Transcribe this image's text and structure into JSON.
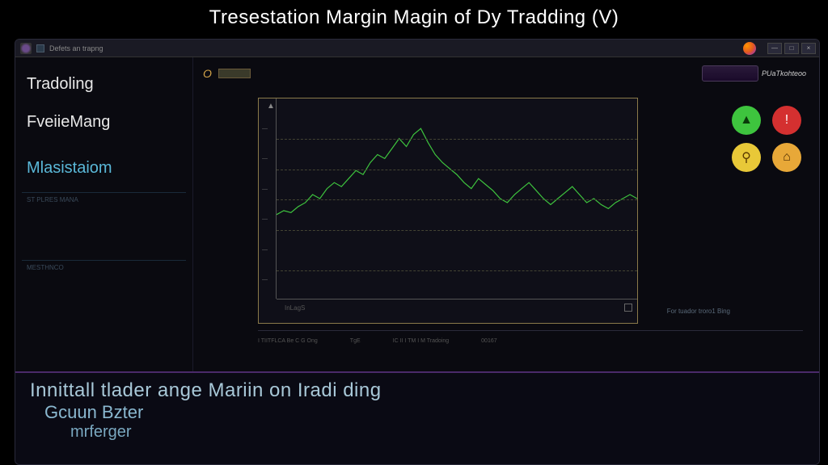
{
  "page_title": "Tresestation Margin Magin of Dy Tradding (V)",
  "titlebar": {
    "label": "Defets an trapng"
  },
  "window_controls": {
    "min": "—",
    "max": "□",
    "close": "×"
  },
  "sidebar": {
    "items": [
      {
        "label": "Tradoling",
        "style": "white"
      },
      {
        "label": "FveiieMang",
        "style": "white"
      },
      {
        "label": "Mlasistaiom",
        "style": "cyan"
      }
    ],
    "faint1": "ST PLRES MANA",
    "faint2": "MESTHNCO"
  },
  "topstrip": {
    "label": "O",
    "mode_text": "PUaTkohteoo"
  },
  "indicators": [
    {
      "name": "up-indicator",
      "class": "ind-green",
      "glyph": "▲"
    },
    {
      "name": "alert-indicator",
      "class": "ind-red",
      "glyph": "!"
    },
    {
      "name": "warn-indicator",
      "class": "ind-yellow",
      "glyph": "⚲"
    },
    {
      "name": "lock-indicator",
      "class": "ind-amber",
      "glyph": "⌂"
    }
  ],
  "chart_data": {
    "type": "line",
    "title": "",
    "xlabel": "InLagS",
    "ylabel": "",
    "ylim": [
      0,
      100
    ],
    "y_ticks": [
      10,
      25,
      40,
      55,
      70,
      85
    ],
    "grid_levels": [
      15,
      35,
      50,
      65,
      80
    ],
    "x": [
      0,
      2,
      4,
      6,
      8,
      10,
      12,
      14,
      16,
      18,
      20,
      22,
      24,
      26,
      28,
      30,
      32,
      34,
      36,
      38,
      40,
      42,
      44,
      46,
      48,
      50,
      52,
      54,
      56,
      58,
      60,
      62,
      64,
      66,
      68,
      70,
      72,
      74,
      76,
      78,
      80,
      82,
      84,
      86,
      88,
      90,
      92,
      94,
      96,
      98,
      100
    ],
    "values": [
      42,
      44,
      43,
      46,
      48,
      52,
      50,
      55,
      58,
      56,
      60,
      64,
      62,
      68,
      72,
      70,
      75,
      80,
      76,
      82,
      85,
      78,
      72,
      68,
      65,
      62,
      58,
      55,
      60,
      57,
      54,
      50,
      48,
      52,
      55,
      58,
      54,
      50,
      47,
      50,
      53,
      56,
      52,
      48,
      50,
      47,
      45,
      48,
      50,
      52,
      50
    ],
    "series_color": "#3ec43e"
  },
  "footer": {
    "hint": "For tuador troro1 Bing",
    "seg1": "I TIITFLCA Be C G Ong",
    "seg2": "TgE",
    "seg3": "IC  II  I  TM  I  M Tradoing",
    "seg4": "00167"
  },
  "bottom": {
    "line1": "Innittall tlader ange  Mariin on Iradi ding",
    "line2": "Gcuun Bzter",
    "line3": "mrferger"
  }
}
